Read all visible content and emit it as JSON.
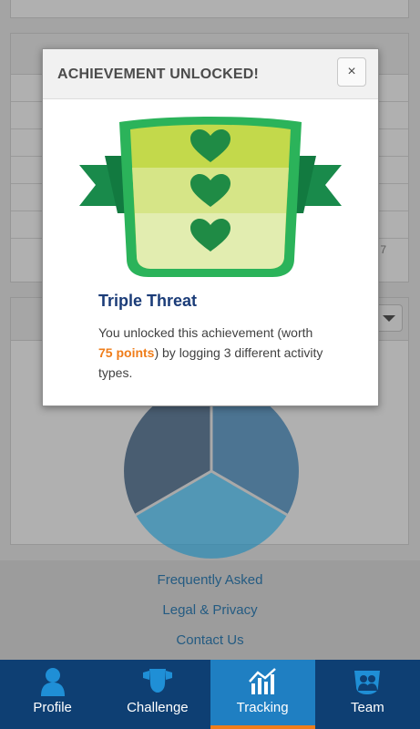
{
  "modal": {
    "title": "ACHIEVEMENT UNLOCKED!",
    "close_icon": "×",
    "achievement_name": "Triple Threat",
    "description_before": "You unlocked this achievement (worth ",
    "points": "75 points",
    "description_after": ") by logging 3 different activity types.",
    "badge_hearts": 3,
    "colors": {
      "ribbon": "#198a4b",
      "shield": "#2bb35a",
      "face_top": "#c3d94b",
      "face_bottom": "#e2edb0",
      "heart": "#1f8b45"
    }
  },
  "background": {
    "table_cell_value": "7",
    "pie_colors": [
      "#1a73ae",
      "#1e9bd0",
      "#0f3e6e"
    ]
  },
  "footer": {
    "links": [
      "Frequently Asked",
      "Legal & Privacy",
      "Contact Us"
    ]
  },
  "nav": {
    "items": [
      {
        "label": "Profile",
        "icon": "person-icon",
        "active": false
      },
      {
        "label": "Challenge",
        "icon": "shield-icon",
        "active": false
      },
      {
        "label": "Tracking",
        "icon": "chart-icon",
        "active": true
      },
      {
        "label": "Team",
        "icon": "team-icon",
        "active": false
      }
    ],
    "colors": {
      "bar": "#0e3f73",
      "active": "#1f7fc2",
      "active_underline": "#ef7d1a"
    }
  }
}
